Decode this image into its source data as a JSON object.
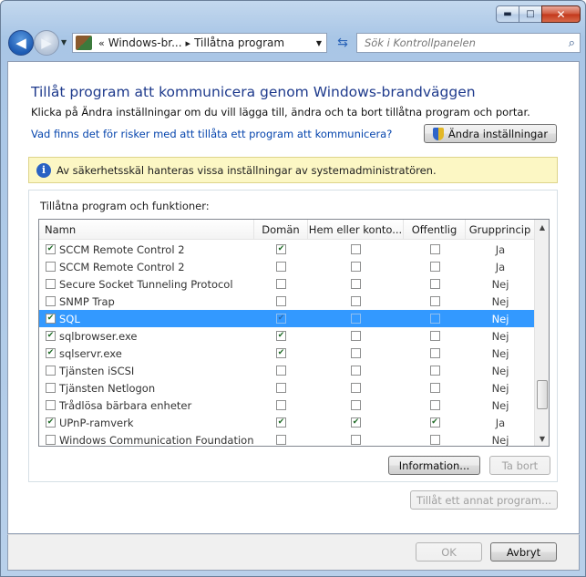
{
  "window": {
    "minimize": "▬",
    "maximize": "□",
    "close": "✕"
  },
  "nav": {
    "back": "◀",
    "forward": "▶",
    "history_dropdown": "▼",
    "breadcrumb": [
      "«",
      "Windows-br...",
      "▸",
      "Tillåtna program"
    ],
    "address_dropdown": "▼",
    "refresh": "⇆",
    "search_placeholder": "Sök i Kontrollpanelen",
    "search_icon": "⌕"
  },
  "main": {
    "heading": "Tillåt program att kommunicera genom Windows-brandväggen",
    "description": "Klicka på Ändra inställningar om du vill lägga till, ändra och ta bort tillåtna program och portar.",
    "risk_link": "Vad finns det för risker med att tillåta ett program att kommunicera?",
    "change_settings_button": "Ändra inställningar",
    "info_icon": "i",
    "info_text": "Av säkerhetsskäl hanteras vissa inställningar av systemadministratören.",
    "list_label": "Tillåtna program och funktioner:",
    "columns": [
      "Namn",
      "Domän",
      "Hem eller konto...",
      "Offentlig",
      "Grupprincip"
    ],
    "rows": [
      {
        "name": "SCCM Remote Control 2",
        "enabled": true,
        "domain": true,
        "home": false,
        "public": false,
        "gp": "Ja"
      },
      {
        "name": "SCCM Remote Control 2",
        "enabled": false,
        "domain": false,
        "home": false,
        "public": false,
        "gp": "Ja"
      },
      {
        "name": "Secure Socket Tunneling Protocol",
        "enabled": false,
        "domain": false,
        "home": false,
        "public": false,
        "gp": "Nej"
      },
      {
        "name": "SNMP Trap",
        "enabled": false,
        "domain": false,
        "home": false,
        "public": false,
        "gp": "Nej"
      },
      {
        "name": "SQL",
        "enabled": true,
        "domain": true,
        "home": false,
        "public": false,
        "gp": "Nej",
        "selected": true
      },
      {
        "name": "sqlbrowser.exe",
        "enabled": true,
        "domain": true,
        "home": false,
        "public": false,
        "gp": "Nej"
      },
      {
        "name": "sqlservr.exe",
        "enabled": true,
        "domain": true,
        "home": false,
        "public": false,
        "gp": "Nej"
      },
      {
        "name": "Tjänsten iSCSI",
        "enabled": false,
        "domain": false,
        "home": false,
        "public": false,
        "gp": "Nej"
      },
      {
        "name": "Tjänsten Netlogon",
        "enabled": false,
        "domain": false,
        "home": false,
        "public": false,
        "gp": "Nej"
      },
      {
        "name": "Trådlösa bärbara enheter",
        "enabled": false,
        "domain": false,
        "home": false,
        "public": false,
        "gp": "Nej"
      },
      {
        "name": "UPnP-ramverk",
        "enabled": true,
        "domain": true,
        "home": true,
        "public": true,
        "gp": "Ja"
      },
      {
        "name": "Windows Communication Foundation",
        "enabled": false,
        "domain": false,
        "home": false,
        "public": false,
        "gp": "Nej"
      }
    ],
    "scroll_up": "▲",
    "scroll_down": "▼",
    "information_button": "Information...",
    "remove_button": "Ta bort",
    "allow_other_button": "Tillåt ett annat program..."
  },
  "footer": {
    "ok_button": "OK",
    "cancel_button": "Avbryt"
  },
  "colors": {
    "selection": "#3399ff",
    "heading": "#1e3a8c",
    "link": "#0645ad",
    "infobar": "#fcf7c4"
  }
}
